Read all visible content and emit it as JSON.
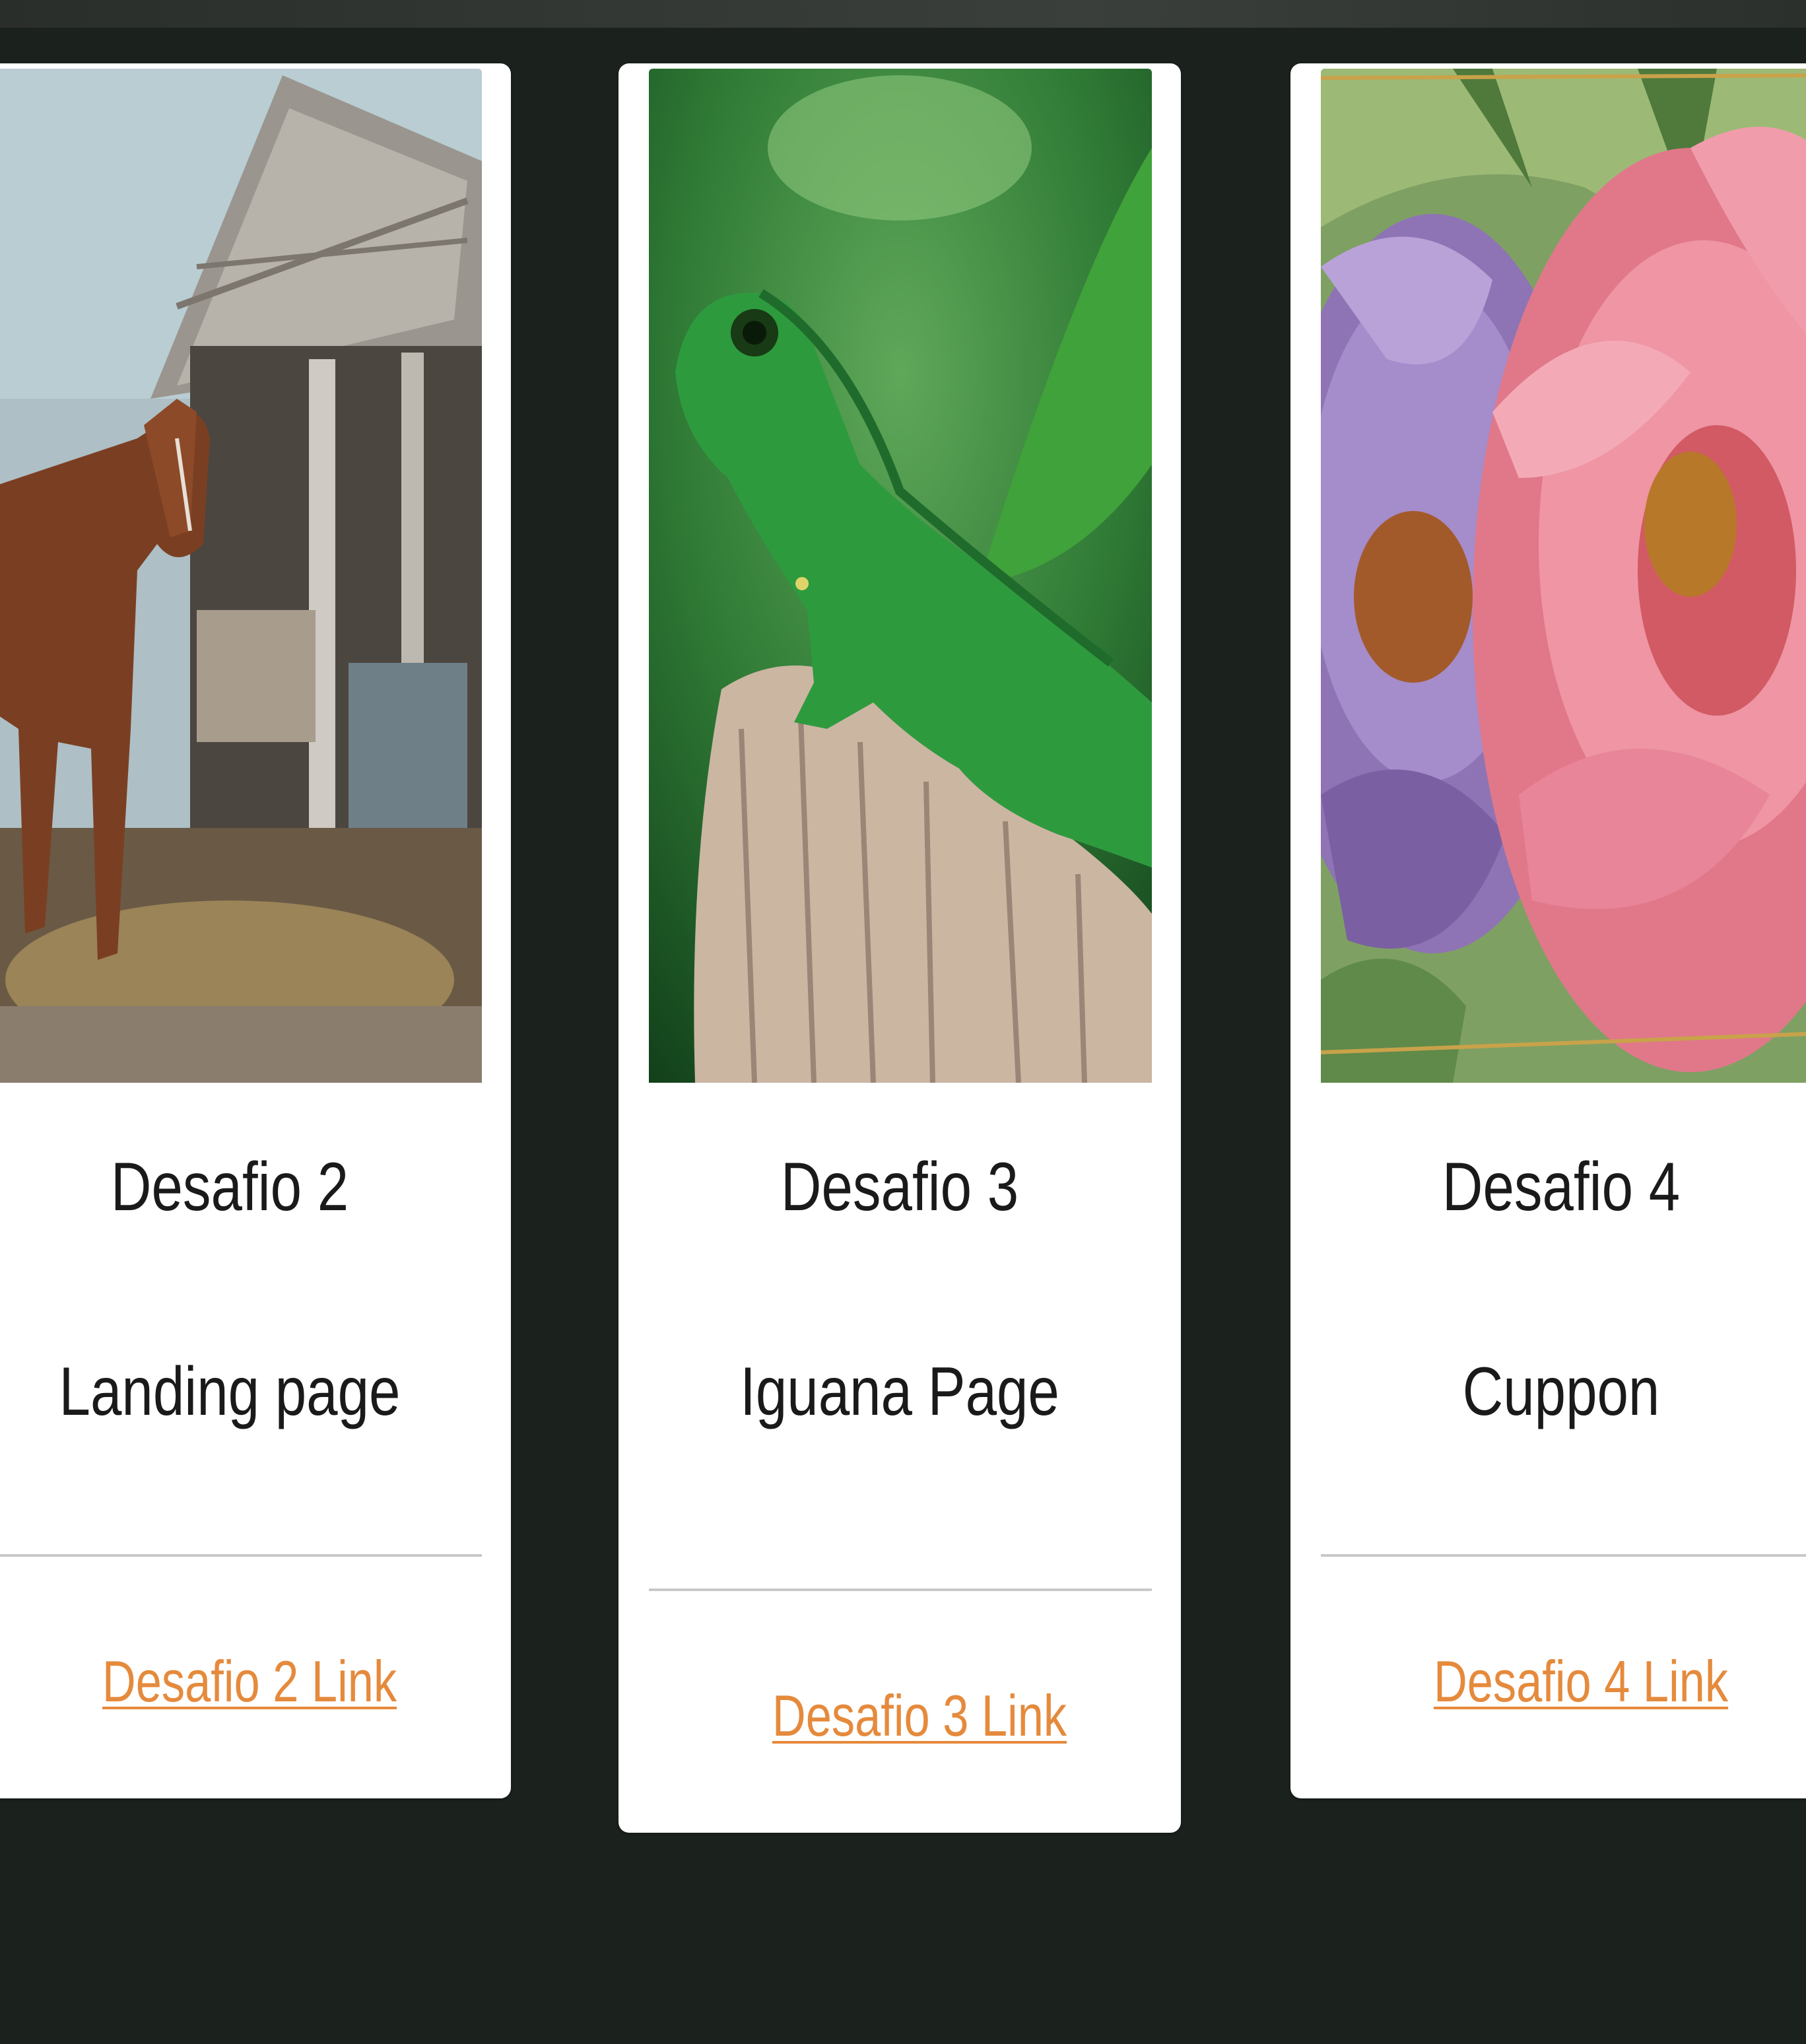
{
  "cards": [
    {
      "title": "Desafio 2",
      "subtitle": "Landing page",
      "link": "Desafio 2 Link",
      "image": "horse-barn-painting"
    },
    {
      "title": "Desafio 3",
      "subtitle": "Iguana Page",
      "link": "Desafio 3 Link",
      "image": "green-iguana-photo"
    },
    {
      "title": "Desafio 4",
      "subtitle": "Cuppon",
      "link": "Desafio 4 Link",
      "image": "peony-flowers-illustration"
    }
  ],
  "colors": {
    "background": "#1b211c",
    "card": "#ffffff",
    "link": "#e58a3c",
    "text": "#1a1a1a"
  }
}
